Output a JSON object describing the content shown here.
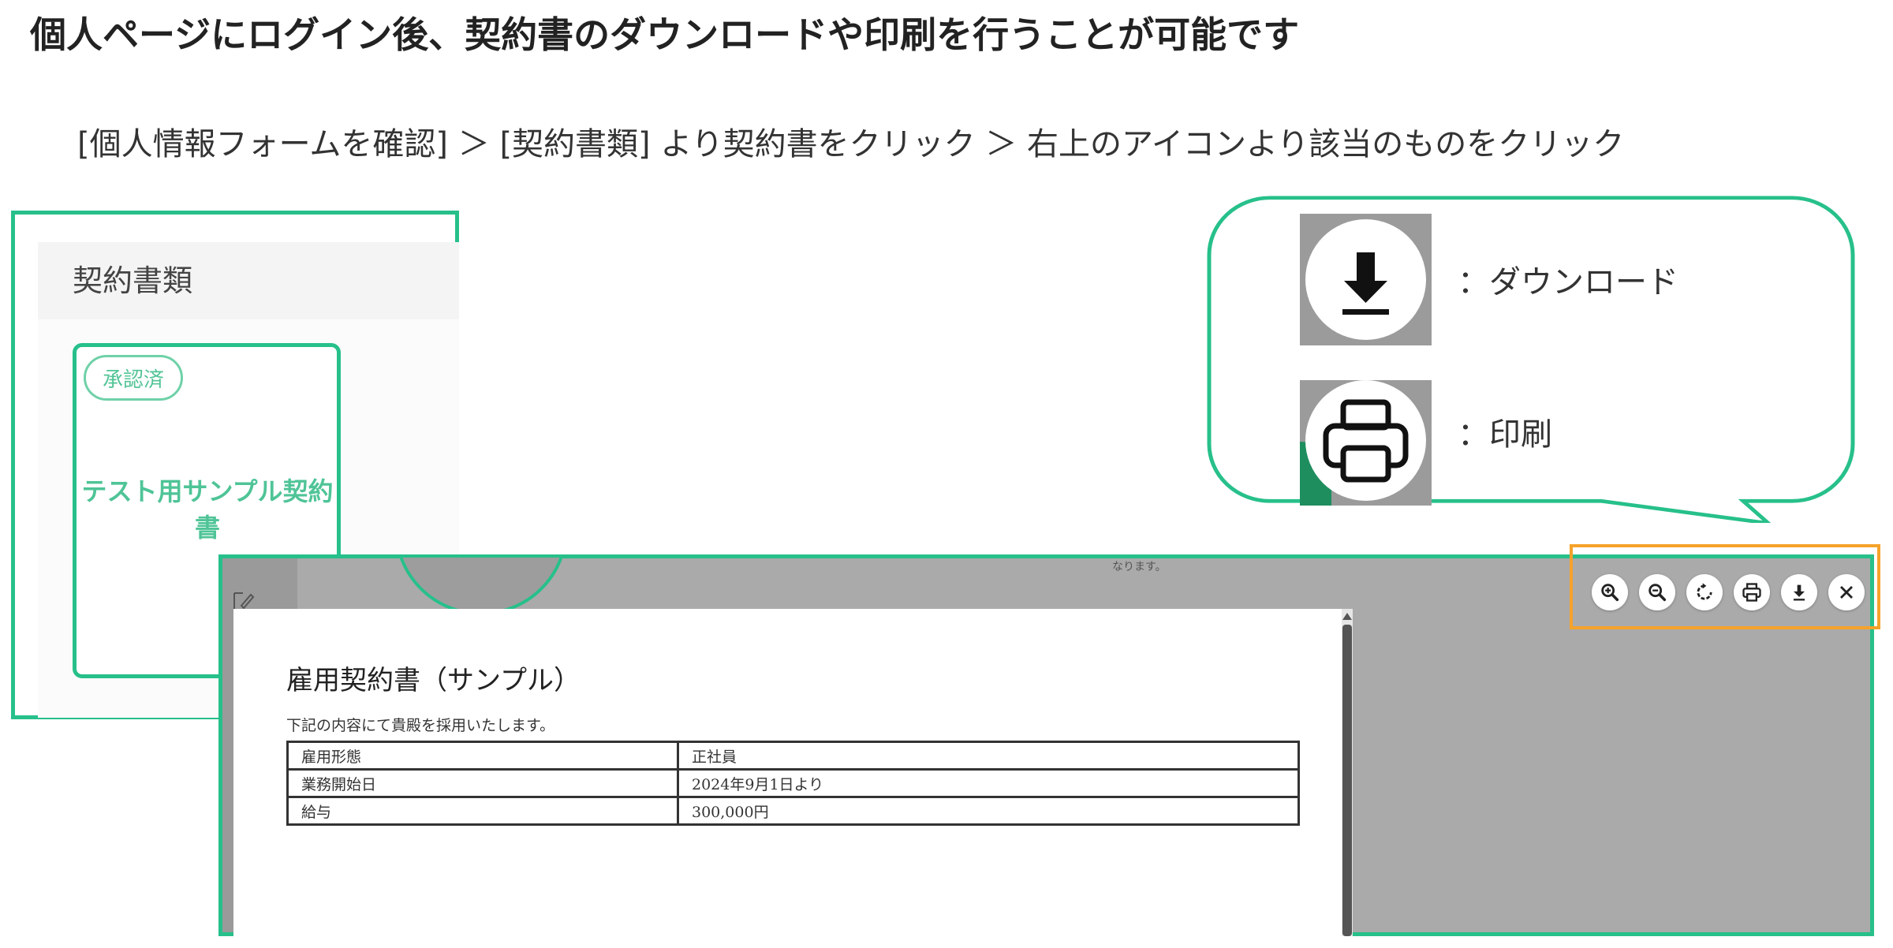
{
  "headline": "個人ページにログイン後、契約書のダウンロードや印刷を行うことが可能です",
  "instruction": "[個人情報フォームを確認] ＞ [契約書類] より契約書をクリック ＞ 右上のアイコンより該当のものをクリック",
  "contract_panel": {
    "title": "契約書類",
    "card": {
      "badge": "承認済",
      "name": "テスト用サンプル契約書"
    }
  },
  "viewer": {
    "background_note": "なります。",
    "toolbar": {
      "buttons": [
        {
          "name": "zoom-in",
          "icon": "zoom-in-icon"
        },
        {
          "name": "zoom-out",
          "icon": "zoom-out-icon"
        },
        {
          "name": "rotate",
          "icon": "rotate-icon"
        },
        {
          "name": "print",
          "icon": "printer-icon"
        },
        {
          "name": "download",
          "icon": "download-icon"
        },
        {
          "name": "close",
          "icon": "close-icon"
        }
      ]
    },
    "document": {
      "title": "雇用契約書（サンプル）",
      "intro": "下記の内容にて貴殿を採用いたします。",
      "rows": [
        {
          "label": "雇用形態",
          "value": "正社員"
        },
        {
          "label": "業務開始日",
          "value": "2024年9月1日より"
        },
        {
          "label": "給与",
          "value": "300,000円"
        }
      ]
    }
  },
  "legend": {
    "download_label": "：ダウンロード",
    "print_label": "：印刷"
  },
  "colors": {
    "accent_green": "#27c08a",
    "highlight_orange": "#f5a22a",
    "viewer_gray": "#aaaaaa"
  }
}
